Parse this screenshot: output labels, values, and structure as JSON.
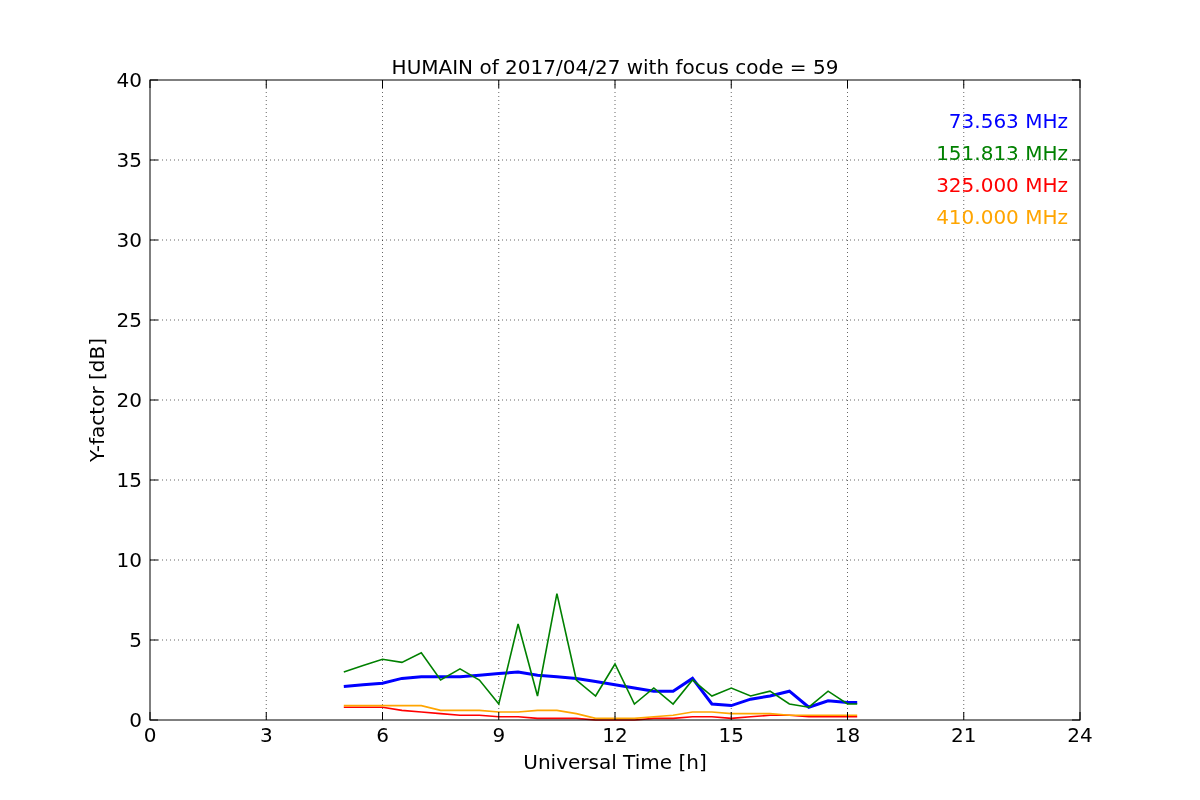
{
  "chart": {
    "chart_data": {
      "type": "line",
      "title": "HUMAIN of 2017/04/27 with focus code = 59",
      "xlabel": "Universal Time [h]",
      "ylabel": "Y-factor [dB]",
      "x": [
        5,
        5.5,
        6,
        6.5,
        7,
        7.5,
        8,
        8.5,
        9,
        9.5,
        10,
        10.5,
        11,
        11.5,
        12,
        12.5,
        13,
        13.5,
        14,
        14.5,
        15,
        15.5,
        16,
        16.5,
        17,
        17.5,
        18,
        18.25
      ],
      "series": [
        {
          "name": "73.563 MHz",
          "color": "#0000ff",
          "values": [
            2.1,
            2.2,
            2.3,
            2.6,
            2.7,
            2.7,
            2.7,
            2.8,
            2.9,
            3.0,
            2.8,
            2.7,
            2.6,
            2.4,
            2.2,
            2.0,
            1.8,
            1.8,
            2.6,
            1.0,
            0.9,
            1.3,
            1.5,
            1.8,
            0.8,
            1.2,
            1.1,
            1.1
          ]
        },
        {
          "name": "151.813 MHz",
          "color": "#008000",
          "values": [
            3.0,
            3.4,
            3.8,
            3.6,
            4.2,
            2.5,
            3.2,
            2.5,
            1.0,
            6.0,
            1.5,
            7.9,
            2.5,
            1.5,
            3.5,
            1.0,
            2.0,
            1.0,
            2.5,
            1.5,
            2.0,
            1.5,
            1.8,
            1.0,
            0.8,
            1.8,
            1.0,
            1.0
          ]
        },
        {
          "name": "325.000 MHz",
          "color": "#ff0000",
          "values": [
            0.8,
            0.8,
            0.8,
            0.6,
            0.5,
            0.4,
            0.3,
            0.3,
            0.2,
            0.2,
            0.1,
            0.1,
            0.1,
            0.0,
            0.0,
            0.0,
            0.1,
            0.1,
            0.2,
            0.2,
            0.1,
            0.2,
            0.3,
            0.3,
            0.2,
            0.2,
            0.2,
            0.2
          ]
        },
        {
          "name": "410.000 MHz",
          "color": "#ffa500",
          "values": [
            0.9,
            0.9,
            0.9,
            0.9,
            0.9,
            0.6,
            0.6,
            0.6,
            0.5,
            0.5,
            0.6,
            0.6,
            0.4,
            0.1,
            0.1,
            0.1,
            0.2,
            0.3,
            0.5,
            0.5,
            0.4,
            0.4,
            0.4,
            0.3,
            0.3,
            0.3,
            0.3,
            0.3
          ]
        }
      ],
      "grid": true,
      "xlim": [
        0,
        24
      ],
      "ylim": [
        0,
        40
      ],
      "xticks": [
        0,
        3,
        6,
        9,
        12,
        15,
        18,
        21,
        24
      ],
      "yticks": [
        0,
        5,
        10,
        15,
        20,
        25,
        30,
        35,
        40
      ]
    }
  }
}
